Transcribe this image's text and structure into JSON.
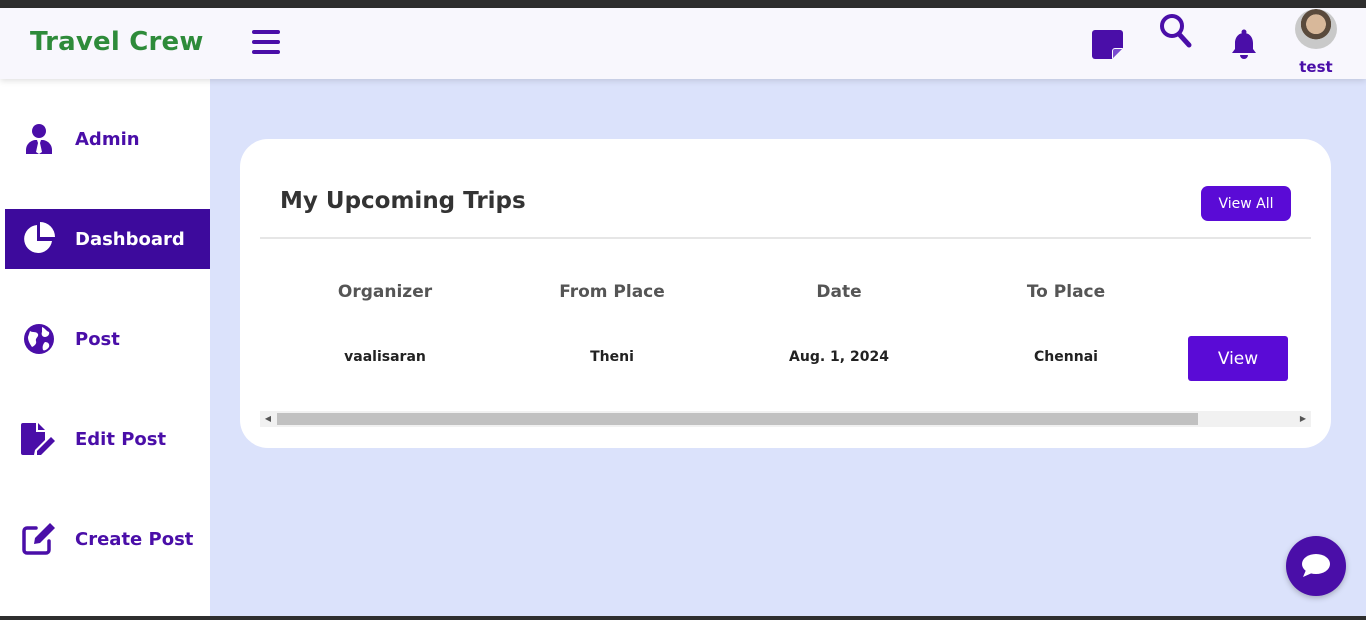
{
  "header": {
    "brand": "Travel Crew",
    "user_name": "test",
    "icons": [
      "menu-icon",
      "sticky-note-icon",
      "search-icon",
      "bell-icon",
      "user-avatar"
    ]
  },
  "sidebar": {
    "items": [
      {
        "label": "Admin",
        "icon": "user-tie-icon",
        "active": false
      },
      {
        "label": "Dashboard",
        "icon": "pie-chart-icon",
        "active": true
      },
      {
        "label": "Post",
        "icon": "globe-icon",
        "active": false
      },
      {
        "label": "Edit Post",
        "icon": "file-edit-icon",
        "active": false
      },
      {
        "label": "Create Post",
        "icon": "pen-square-icon",
        "active": false
      }
    ]
  },
  "card": {
    "title": "My Upcoming Trips",
    "view_all_label": "View All",
    "columns": [
      "Organizer",
      "From Place",
      "Date",
      "To Place"
    ],
    "rows": [
      {
        "organizer": "vaalisaran",
        "from": "Theni",
        "date": "Aug. 1, 2024",
        "to": "Chennai",
        "action": "View"
      }
    ]
  },
  "colors": {
    "brand_green": "#2e8b3a",
    "primary_purple": "#5a0bd6",
    "dark_purple": "#4a0ea8",
    "main_bg": "#dbe2fb"
  },
  "chat": {
    "icon": "chat-bubble-icon"
  }
}
